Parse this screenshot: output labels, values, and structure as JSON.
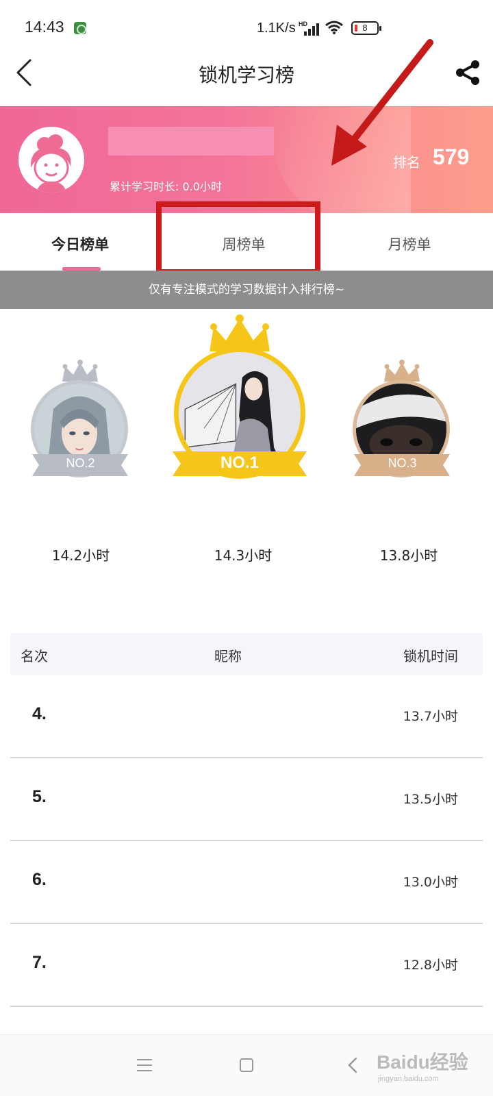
{
  "status_bar": {
    "time": "14:43",
    "speed": "1.1K/s",
    "hd": "HD",
    "battery": "8"
  },
  "nav": {
    "title": "锁机学习榜",
    "back_icon": "chevron-left-icon",
    "share_icon": "share-icon"
  },
  "profile": {
    "total_label": "累计学习时长: 0.0小时",
    "rank_label": "排名",
    "rank_value": "579"
  },
  "tabs": [
    {
      "label": "今日榜单",
      "active": true
    },
    {
      "label": "周榜单",
      "active": false
    },
    {
      "label": "月榜单",
      "active": false
    }
  ],
  "notice": "仅有专注模式的学习数据计入排行榜~",
  "podium": [
    {
      "badge": "NO.2",
      "time": "14.2小时"
    },
    {
      "badge": "NO.1",
      "time": "14.3小时"
    },
    {
      "badge": "NO.3",
      "time": "13.8小时"
    }
  ],
  "table": {
    "headers": [
      "名次",
      "昵称",
      "锁机时间"
    ],
    "rows": [
      {
        "rank": "4.",
        "time": "13.7小时"
      },
      {
        "rank": "5.",
        "time": "13.5小时"
      },
      {
        "rank": "6.",
        "time": "13.0小时"
      },
      {
        "rank": "7.",
        "time": "12.8小时"
      }
    ]
  },
  "watermark": {
    "text": "Baidu经验",
    "sub": "jingyan.baidu.com"
  },
  "colors": {
    "accent": "#f06b95",
    "highlight": "#cc1b1b",
    "gold": "#f5c518",
    "silver": "#b8bcc4",
    "bronze": "#d8b08a"
  }
}
